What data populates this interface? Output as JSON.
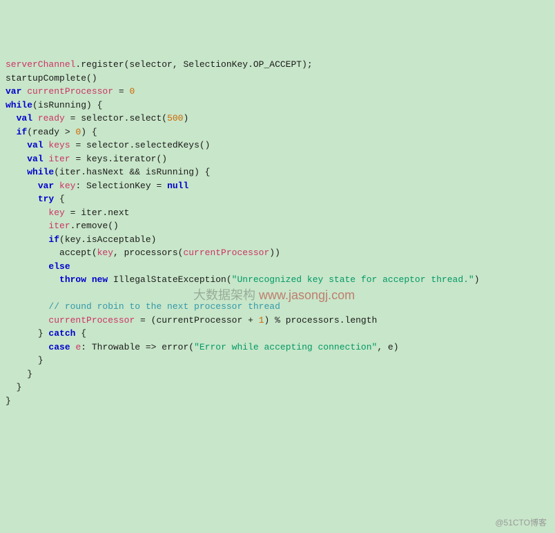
{
  "code": {
    "l01_p1": "serverChannel",
    "l01_p2": ".register(selector, SelectionKey.OP_ACCEPT);",
    "l02": "startupComplete()",
    "l03_kw": "var",
    "l03_var": " currentProcessor",
    "l03_rest": " = ",
    "l03_num": "0",
    "l04_kw": "while",
    "l04_rest": "(isRunning) {",
    "l05_kw": "val",
    "l05_var": " ready",
    "l05_rest": " = selector.select(",
    "l05_num": "500",
    "l05_end": ")",
    "l06_kw": "if",
    "l06_rest": "(ready > ",
    "l06_num": "0",
    "l06_end": ") {",
    "l07_kw": "val",
    "l07_var": " keys",
    "l07_rest": " = selector.selectedKeys()",
    "l08_kw": "val",
    "l08_var": " iter",
    "l08_rest": " = keys.iterator()",
    "l09_kw": "while",
    "l09_rest": "(iter.hasNext && isRunning) {",
    "l10_kw": "var",
    "l10_var": " key",
    "l10_rest": ": SelectionKey = ",
    "l10_null": "null",
    "l11_kw": "try",
    "l11_rest": " {",
    "l12_var": "key",
    "l12_rest": " = iter.next",
    "l13_var": "iter",
    "l13_rest": ".remove()",
    "l14_kw": "if",
    "l14_rest": "(key.isAcceptable)",
    "l15_pre": "accept(",
    "l15_var1": "key",
    "l15_mid": ", processors(",
    "l15_var2": "currentProcessor",
    "l15_end": "))",
    "l16_kw": "else",
    "l17_kw": "throw new",
    "l17_rest": " IllegalStateException(",
    "l17_str": "\"Unrecognized key state for acceptor thread.\"",
    "l17_end": ")",
    "l18_comment": "// round robin to the next processor thread",
    "l19_var": "currentProcessor",
    "l19_rest": " = (currentProcessor + ",
    "l19_num": "1",
    "l19_end": ") % processors.length",
    "l20_close": "} ",
    "l20_kw": "catch",
    "l20_rest": " {",
    "l21_kw": "case",
    "l21_var": " e",
    "l21_rest": ": Throwable => error(",
    "l21_str": "\"Error while accepting connection\"",
    "l21_end": ", e)",
    "l22_close": "}",
    "l23_close": "}",
    "l24_close": "}",
    "l25_close": "}"
  },
  "watermark": "@51CTO博客",
  "center_watermark_text": "大数据架构 ",
  "center_watermark_url": "www.jasongj.com"
}
